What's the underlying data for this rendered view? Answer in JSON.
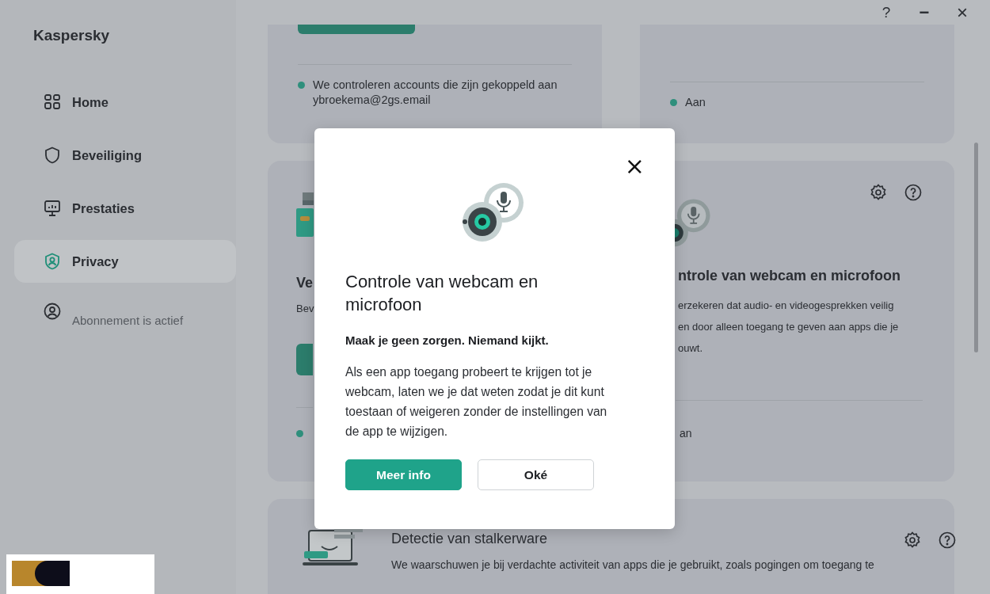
{
  "window": {
    "title": "Kaspersky",
    "controls": [
      {
        "kind": "help",
        "label": "?"
      },
      {
        "kind": "minimize",
        "label": "−"
      },
      {
        "kind": "close",
        "label": "×"
      }
    ]
  },
  "sidebar": {
    "items": [
      {
        "kind": "home",
        "label": "Home",
        "selected": false
      },
      {
        "kind": "security",
        "label": "Beveiliging",
        "selected": false
      },
      {
        "kind": "performance",
        "label": "Prestaties",
        "selected": false
      },
      {
        "kind": "privacy",
        "label": "Privacy",
        "selected": true
      }
    ],
    "subscription": "Abonnement is actief"
  },
  "cards": {
    "top_left": {
      "status": "We controleren accounts die zijn gekoppeld aan ybroekema@2gs.email",
      "color": "#2f8f7c"
    },
    "top_right": {
      "status": "Aan",
      "color": "#2f8f7c"
    },
    "middle_left": {
      "title": "Ve",
      "description": "Bev",
      "color": "#2f8f7c"
    },
    "middle_right": {
      "title": "ntrole van webcam en microfoon",
      "description": "erzekeren dat audio- en videogesprekken veilig\nen door alleen toegang te geven aan apps die je\nouwt.",
      "status": "an"
    },
    "bottom": {
      "title": "Detectie van stalkerware",
      "description": "We waarschuwen je bij verdachte activiteit van apps die je gebruikt, zoals pogingen om toegang te"
    }
  },
  "dialog": {
    "close": "×",
    "title": "Controle van webcam en microfoon",
    "subtitle": "Maak je geen zorgen. Niemand kijkt.",
    "body": "Als een app toegang probeert te krijgen tot je webcam, laten we je dat weten zodat je dit kunt toestaan of weigeren zonder de instellingen van de app te wijzigen.",
    "buttons": [
      {
        "kind": "primary",
        "label": "Meer info"
      },
      {
        "kind": "secondary",
        "label": "Oké"
      }
    ]
  }
}
